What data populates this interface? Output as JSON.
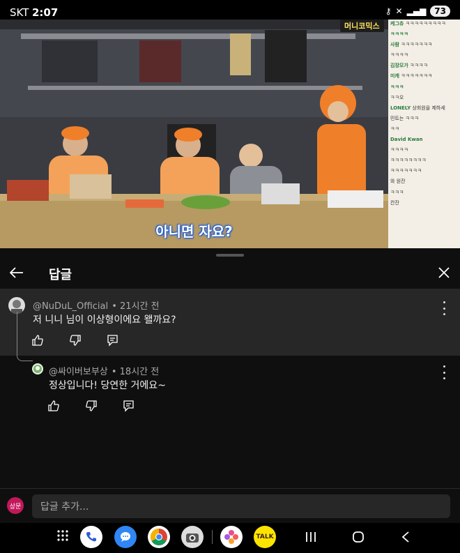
{
  "status": {
    "carrier": "SKT",
    "time": "2:07",
    "battery": "73"
  },
  "video": {
    "channel_badge": "머니코믹스",
    "subtitle": "아니면 자요?",
    "chat": [
      {
        "user": "케그츄",
        "text": "ㅋㅋㅋㅋㅋㅋㅋㅋㅋ"
      },
      {
        "user": "ㅋㅋㅋㅋ",
        "text": ""
      },
      {
        "user": "사람",
        "text": "ㅋㅋㅋㅋㅋㅋㅋ"
      },
      {
        "user": "",
        "text": "ㅋㅋㅋㅋ"
      },
      {
        "user": "김장모가",
        "text": "ㅋㅋㅋㅋ"
      },
      {
        "user": "미캐",
        "text": "ㅋㅋㅋㅋㅋㅋㅋ"
      },
      {
        "user": "ㅋㅋㅋ",
        "text": ""
      },
      {
        "user": "",
        "text": "ㅋㅋ오"
      },
      {
        "user": "LONELY",
        "text": "상회원을 제하세"
      },
      {
        "user": "",
        "text": "민트는 ㅋㅋㅋ"
      },
      {
        "user": "",
        "text": "ㅋㅋ"
      },
      {
        "user": "David Kwan",
        "text": ""
      },
      {
        "user": "",
        "text": "ㅋㅋㅋㅋ"
      },
      {
        "user": "",
        "text": "ㅋㅋㅋㅋㅋㅋㅋㅋ"
      },
      {
        "user": "",
        "text": "ㅋㅋㅋㅋㅋㅋㅋ"
      },
      {
        "user": "",
        "text": "와 원잔"
      },
      {
        "user": "",
        "text": "ㅋㅋㅋ"
      },
      {
        "user": "",
        "text": "칸잔"
      }
    ]
  },
  "header": {
    "title": "답글"
  },
  "parent_comment": {
    "handle": "@NuDuL_Official",
    "time": "• 21시간 전",
    "text": "저 니니 님이 이상형이에요 왤까요?"
  },
  "reply": {
    "handle": "@싸이버보부상",
    "time": "• 18시간 전",
    "text": "정상입니다! 당연한 거에요~"
  },
  "input": {
    "avatar_label": "상문",
    "placeholder": "답글 추가..."
  },
  "dock": {
    "talk_label": "TALK"
  },
  "colors": {
    "background": "#0f0f0f",
    "parent_bg": "#272727",
    "avatar_input": "#c2185b",
    "kakao": "#fee500"
  }
}
